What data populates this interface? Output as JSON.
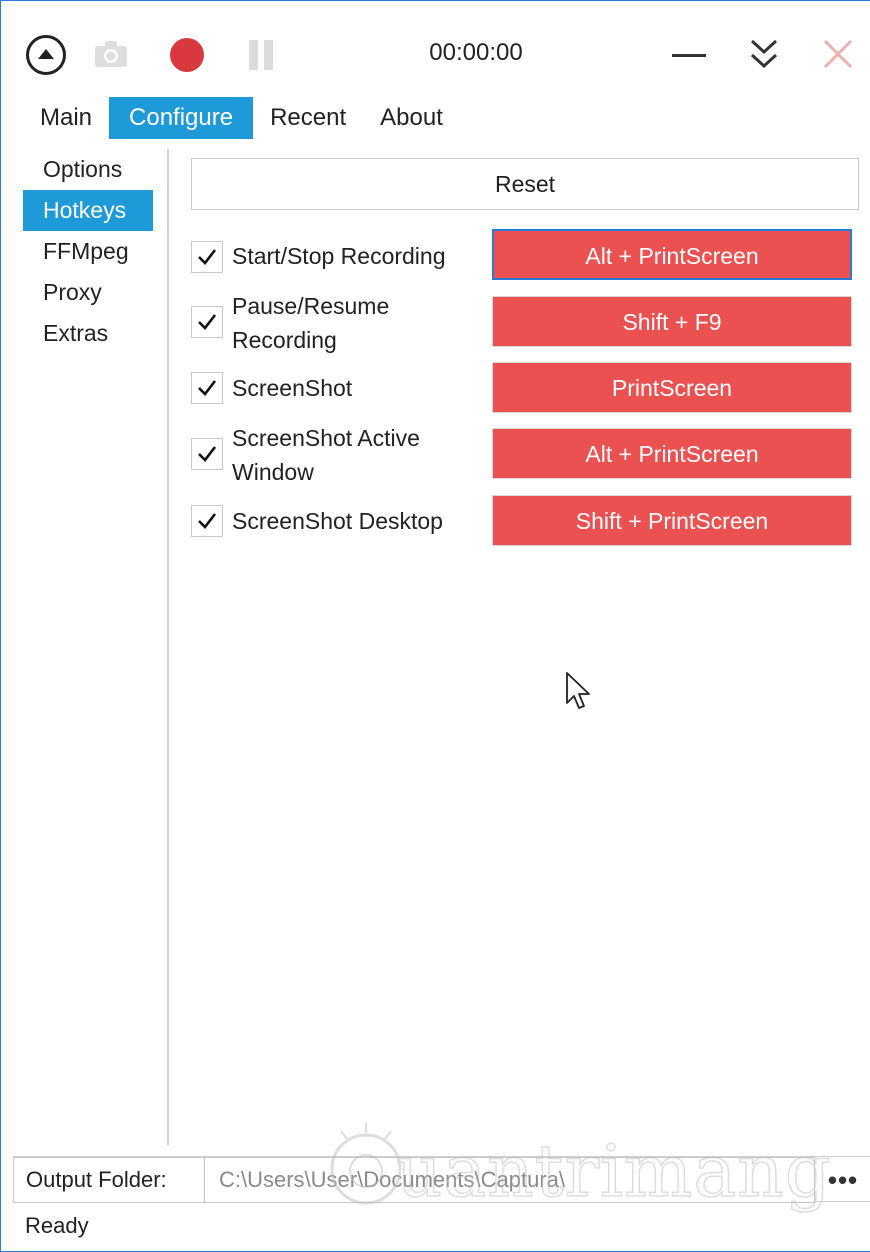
{
  "toolbar": {
    "timer": "00:00:00",
    "icons": {
      "collapse": "collapse-up-icon",
      "screenshot": "camera-icon",
      "record": "record-icon",
      "pause": "pause-icon",
      "minimize": "minimize-icon",
      "expand": "double-chevron-down-icon",
      "close": "close-icon"
    },
    "record_color": "#d9393e",
    "close_color": "#f0b0b0"
  },
  "tabs": [
    {
      "label": "Main",
      "active": false
    },
    {
      "label": "Configure",
      "active": true
    },
    {
      "label": "Recent",
      "active": false
    },
    {
      "label": "About",
      "active": false
    }
  ],
  "sidebar": {
    "items": [
      {
        "label": "Options",
        "active": false
      },
      {
        "label": "Hotkeys",
        "active": true
      },
      {
        "label": "FFMpeg",
        "active": false
      },
      {
        "label": "Proxy",
        "active": false
      },
      {
        "label": "Extras",
        "active": false
      }
    ]
  },
  "hotkeys": {
    "reset_label": "Reset",
    "key_color": "#ec5151",
    "rows": [
      {
        "label": "Start/Stop Recording",
        "checked": true,
        "key": "Alt + PrintScreen"
      },
      {
        "label": "Pause/Resume Recording",
        "checked": true,
        "key": "Shift + F9"
      },
      {
        "label": "ScreenShot",
        "checked": true,
        "key": "PrintScreen"
      },
      {
        "label": "ScreenShot Active Window",
        "checked": true,
        "key": "Alt + PrintScreen"
      },
      {
        "label": "ScreenShot Desktop",
        "checked": true,
        "key": "Shift + PrintScreen"
      }
    ]
  },
  "output": {
    "label": "Output Folder:",
    "path": "C:\\Users\\User\\Documents\\Captura\\",
    "browse_label": "•••"
  },
  "status": "Ready",
  "watermark": "uantrimang",
  "accent_color": "#1e9ad8"
}
